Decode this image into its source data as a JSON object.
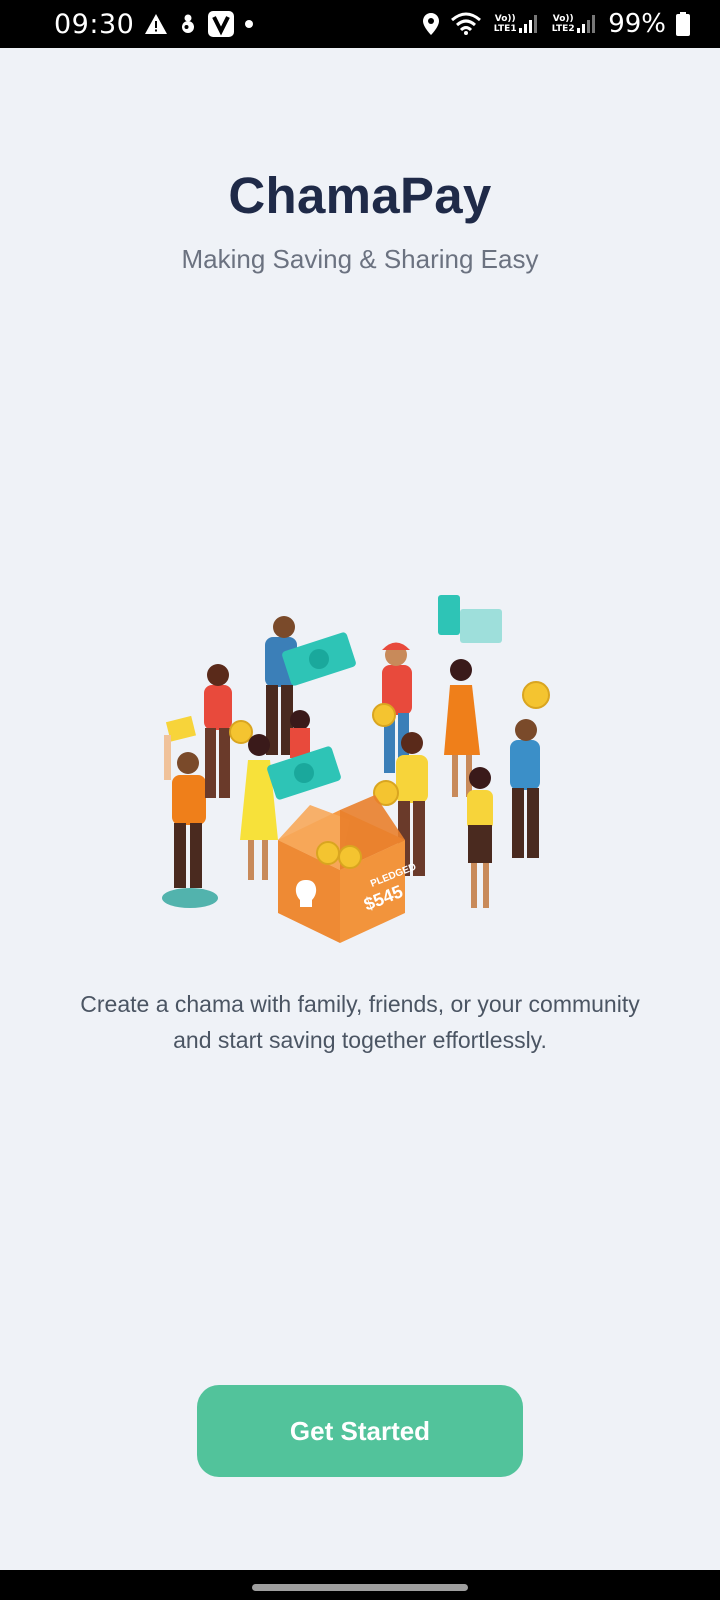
{
  "status_bar": {
    "time": "09:30",
    "battery": "99%",
    "icons": [
      "alert-icon",
      "notification-icon",
      "v-app-icon",
      "dot-icon",
      "location-icon",
      "wifi-icon",
      "signal-lte1-icon",
      "signal-lte2-icon",
      "battery-icon"
    ],
    "lte1_label": "Vo)) LTE1",
    "lte2_label": "Vo)) LTE2"
  },
  "header": {
    "title": "ChamaPay",
    "subtitle": "Making Saving & Sharing Easy"
  },
  "illustration": {
    "icon": "community-savings-illustration",
    "box_label_top": "PLEDGED",
    "box_label_amount": "$545"
  },
  "description": "Create a chama with family, friends, or your community and start saving together effortlessly.",
  "cta": {
    "label": "Get Started"
  },
  "colors": {
    "background": "#eff2f7",
    "title": "#1f2a48",
    "accent": "#52c39b",
    "box": "#ee8a34",
    "money": "#2ec4b6",
    "coin": "#f4c430"
  }
}
